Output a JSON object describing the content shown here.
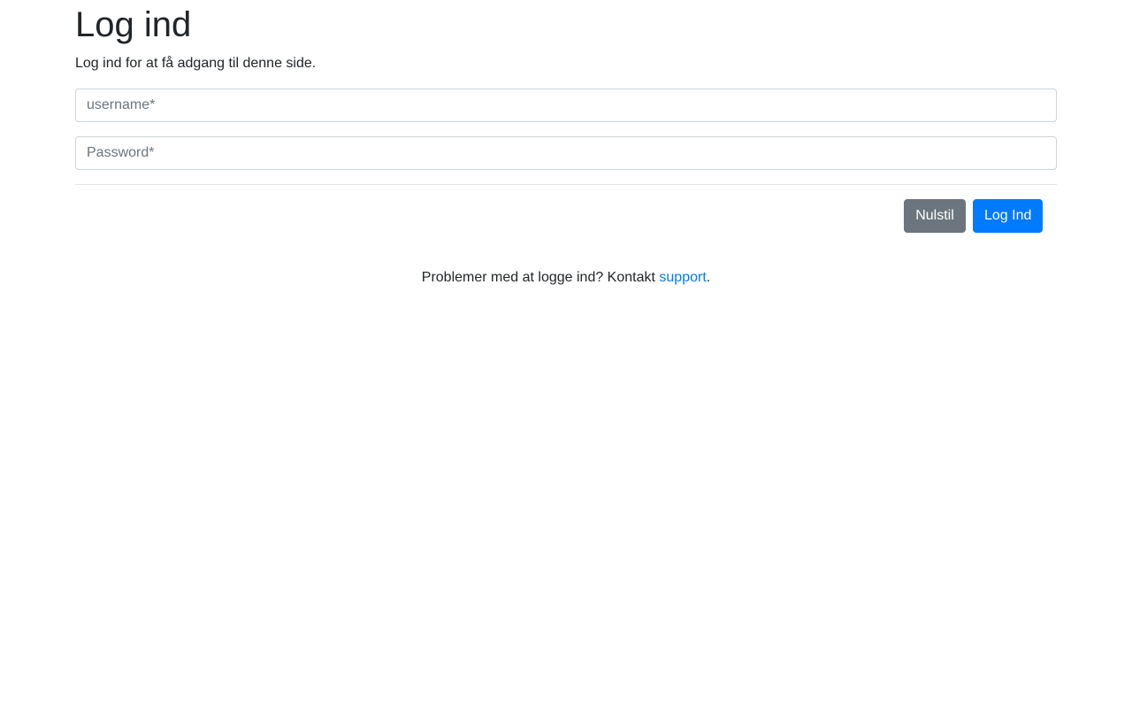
{
  "page": {
    "title": "Log ind",
    "subtitle": "Log ind for at få adgang til denne side."
  },
  "form": {
    "username": {
      "value": "",
      "placeholder": "username*"
    },
    "password": {
      "value": "",
      "placeholder": "Password*"
    },
    "reset_label": "Nulstil",
    "submit_label": "Log Ind"
  },
  "help": {
    "text": "Problemer med at logge ind? Kontakt ",
    "link_label": "support",
    "suffix": "."
  },
  "colors": {
    "primary": "#007bff",
    "secondary": "#6c757d",
    "text": "#212529",
    "border": "#ced4da"
  }
}
